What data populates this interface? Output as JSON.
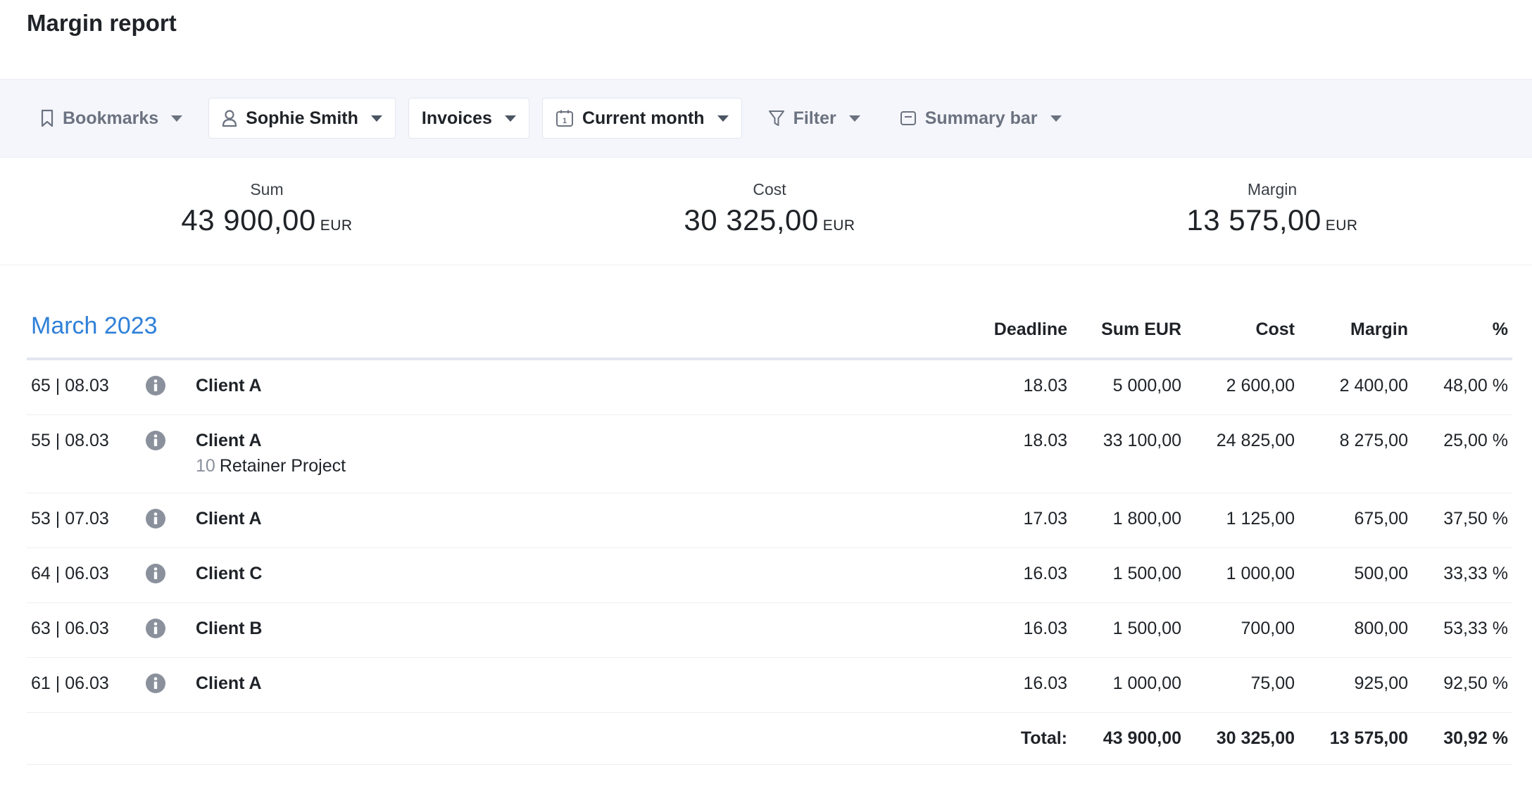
{
  "page": {
    "title": "Margin report"
  },
  "toolbar": {
    "bookmarks": "Bookmarks",
    "user": "Sophie Smith",
    "doc_type": "Invoices",
    "period": "Current month",
    "filter": "Filter",
    "summary_bar": "Summary bar"
  },
  "summary": {
    "sum": {
      "label": "Sum",
      "value": "43 900,00",
      "currency": "EUR"
    },
    "cost": {
      "label": "Cost",
      "value": "30 325,00",
      "currency": "EUR"
    },
    "margin": {
      "label": "Margin",
      "value": "13 575,00",
      "currency": "EUR"
    }
  },
  "table": {
    "month": "March 2023",
    "headers": {
      "deadline": "Deadline",
      "sum": "Sum EUR",
      "cost": "Cost",
      "margin": "Margin",
      "pct": "%"
    },
    "rows": [
      {
        "id": "65 | 08.03",
        "client": "Client A",
        "sub_num": "",
        "sub_name": "",
        "deadline": "18.03",
        "sum": "5 000,00",
        "cost": "2 600,00",
        "margin": "2 400,00",
        "pct": "48,00 %"
      },
      {
        "id": "55 | 08.03",
        "client": "Client A",
        "sub_num": "10",
        "sub_name": "Retainer Project",
        "deadline": "18.03",
        "sum": "33 100,00",
        "cost": "24 825,00",
        "margin": "8 275,00",
        "pct": "25,00 %"
      },
      {
        "id": "53 | 07.03",
        "client": "Client A",
        "sub_num": "",
        "sub_name": "",
        "deadline": "17.03",
        "sum": "1 800,00",
        "cost": "1 125,00",
        "margin": "675,00",
        "pct": "37,50 %"
      },
      {
        "id": "64 | 06.03",
        "client": "Client C",
        "sub_num": "",
        "sub_name": "",
        "deadline": "16.03",
        "sum": "1 500,00",
        "cost": "1 000,00",
        "margin": "500,00",
        "pct": "33,33 %"
      },
      {
        "id": "63 | 06.03",
        "client": "Client B",
        "sub_num": "",
        "sub_name": "",
        "deadline": "16.03",
        "sum": "1 500,00",
        "cost": "700,00",
        "margin": "800,00",
        "pct": "53,33 %"
      },
      {
        "id": "61 | 06.03",
        "client": "Client A",
        "sub_num": "",
        "sub_name": "",
        "deadline": "16.03",
        "sum": "1 000,00",
        "cost": "75,00",
        "margin": "925,00",
        "pct": "92,50 %"
      }
    ],
    "total": {
      "label": "Total:",
      "sum": "43 900,00",
      "cost": "30 325,00",
      "margin": "13 575,00",
      "pct": "30,92 %"
    }
  },
  "colors": {
    "accent": "#2f80d8",
    "toolbar_bg": "#f5f6fb",
    "icon_gray": "#8b919c"
  }
}
